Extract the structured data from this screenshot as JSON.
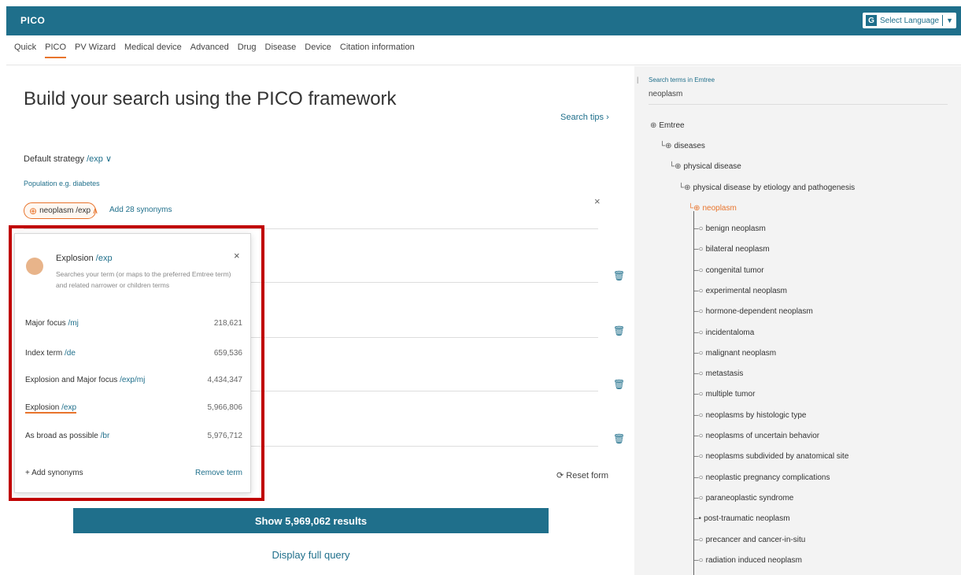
{
  "app": {
    "title": "PICO"
  },
  "language": {
    "label": "Select Language",
    "icon": "google-translate-icon",
    "caret": "▼"
  },
  "nav": {
    "tabs": [
      {
        "label": "Quick",
        "active": false
      },
      {
        "label": "PICO",
        "active": true
      },
      {
        "label": "PV Wizard",
        "active": false
      },
      {
        "label": "Medical device",
        "active": false
      },
      {
        "label": "Advanced",
        "active": false
      },
      {
        "label": "Drug",
        "active": false
      },
      {
        "label": "Disease",
        "active": false
      },
      {
        "label": "Device",
        "active": false
      },
      {
        "label": "Citation information",
        "active": false
      }
    ]
  },
  "main": {
    "title": "Build your search using the PICO framework",
    "search_tips": "Search tips ›",
    "default_strategy_label": "Default strategy",
    "default_strategy_value": "/exp ∨",
    "population_label": "Population e.g. diabetes",
    "term_chip": {
      "prefix": "⊕",
      "label": "neoplasm /exp",
      "chevron": "∧"
    },
    "add_synonyms_link": "Add 28 synonyms",
    "row_close": "×",
    "reset_form": "⟳ Reset form",
    "show_results_button": "Show 5,969,062 results",
    "display_full_query": "Display full query"
  },
  "popup": {
    "title": "Explosion",
    "title_code": "/exp",
    "close": "×",
    "description": "Searches your term (or maps to the preferred Emtree term) and related narrower or children terms",
    "options": [
      {
        "label": "Major focus",
        "code": "/mj",
        "count": "218,621",
        "selected": false
      },
      {
        "label": "Index term",
        "code": "/de",
        "count": "659,536",
        "selected": false
      },
      {
        "label": "Explosion and Major focus",
        "code": "/exp/mj",
        "count": "4,434,347",
        "selected": false
      },
      {
        "label": "Explosion",
        "code": "/exp",
        "count": "5,966,806",
        "selected": true
      },
      {
        "label": "As broad as possible",
        "code": "/br",
        "count": "5,976,712",
        "selected": false
      }
    ],
    "add_synonyms": "+ Add synonyms",
    "remove_term": "Remove term"
  },
  "side": {
    "header": "Search terms in Emtree",
    "term": "neoplasm",
    "tree": [
      {
        "label": "Emtree",
        "glyph": "⊕",
        "level": 0,
        "current": false
      },
      {
        "label": "diseases",
        "glyph": "└⊕",
        "level": 1,
        "current": false
      },
      {
        "label": "physical disease",
        "glyph": "└⊕",
        "level": 2,
        "current": false
      },
      {
        "label": "physical disease by etiology and pathogenesis",
        "glyph": "└⊕",
        "level": 3,
        "current": false
      },
      {
        "label": "neoplasm",
        "glyph": "└⊕",
        "level": 4,
        "current": true
      }
    ],
    "children": [
      {
        "label": "benign neoplasm",
        "glyph": "–○"
      },
      {
        "label": "bilateral neoplasm",
        "glyph": "–○"
      },
      {
        "label": "congenital tumor",
        "glyph": "–○"
      },
      {
        "label": "experimental neoplasm",
        "glyph": "–○"
      },
      {
        "label": "hormone-dependent neoplasm",
        "glyph": "–○"
      },
      {
        "label": "incidentaloma",
        "glyph": "–○"
      },
      {
        "label": "malignant neoplasm",
        "glyph": "–○"
      },
      {
        "label": "metastasis",
        "glyph": "–○"
      },
      {
        "label": "multiple tumor",
        "glyph": "–○"
      },
      {
        "label": "neoplasms by histologic type",
        "glyph": "–○"
      },
      {
        "label": "neoplasms of uncertain behavior",
        "glyph": "–○"
      },
      {
        "label": "neoplasms subdivided by anatomical site",
        "glyph": "–○"
      },
      {
        "label": "neoplastic pregnancy complications",
        "glyph": "–○"
      },
      {
        "label": "paraneoplastic syndrome",
        "glyph": "–○"
      },
      {
        "label": "post-traumatic neoplasm",
        "glyph": "–•"
      },
      {
        "label": "precancer and cancer-in-situ",
        "glyph": "–○"
      },
      {
        "label": "radiation induced neoplasm",
        "glyph": "–○"
      }
    ]
  }
}
